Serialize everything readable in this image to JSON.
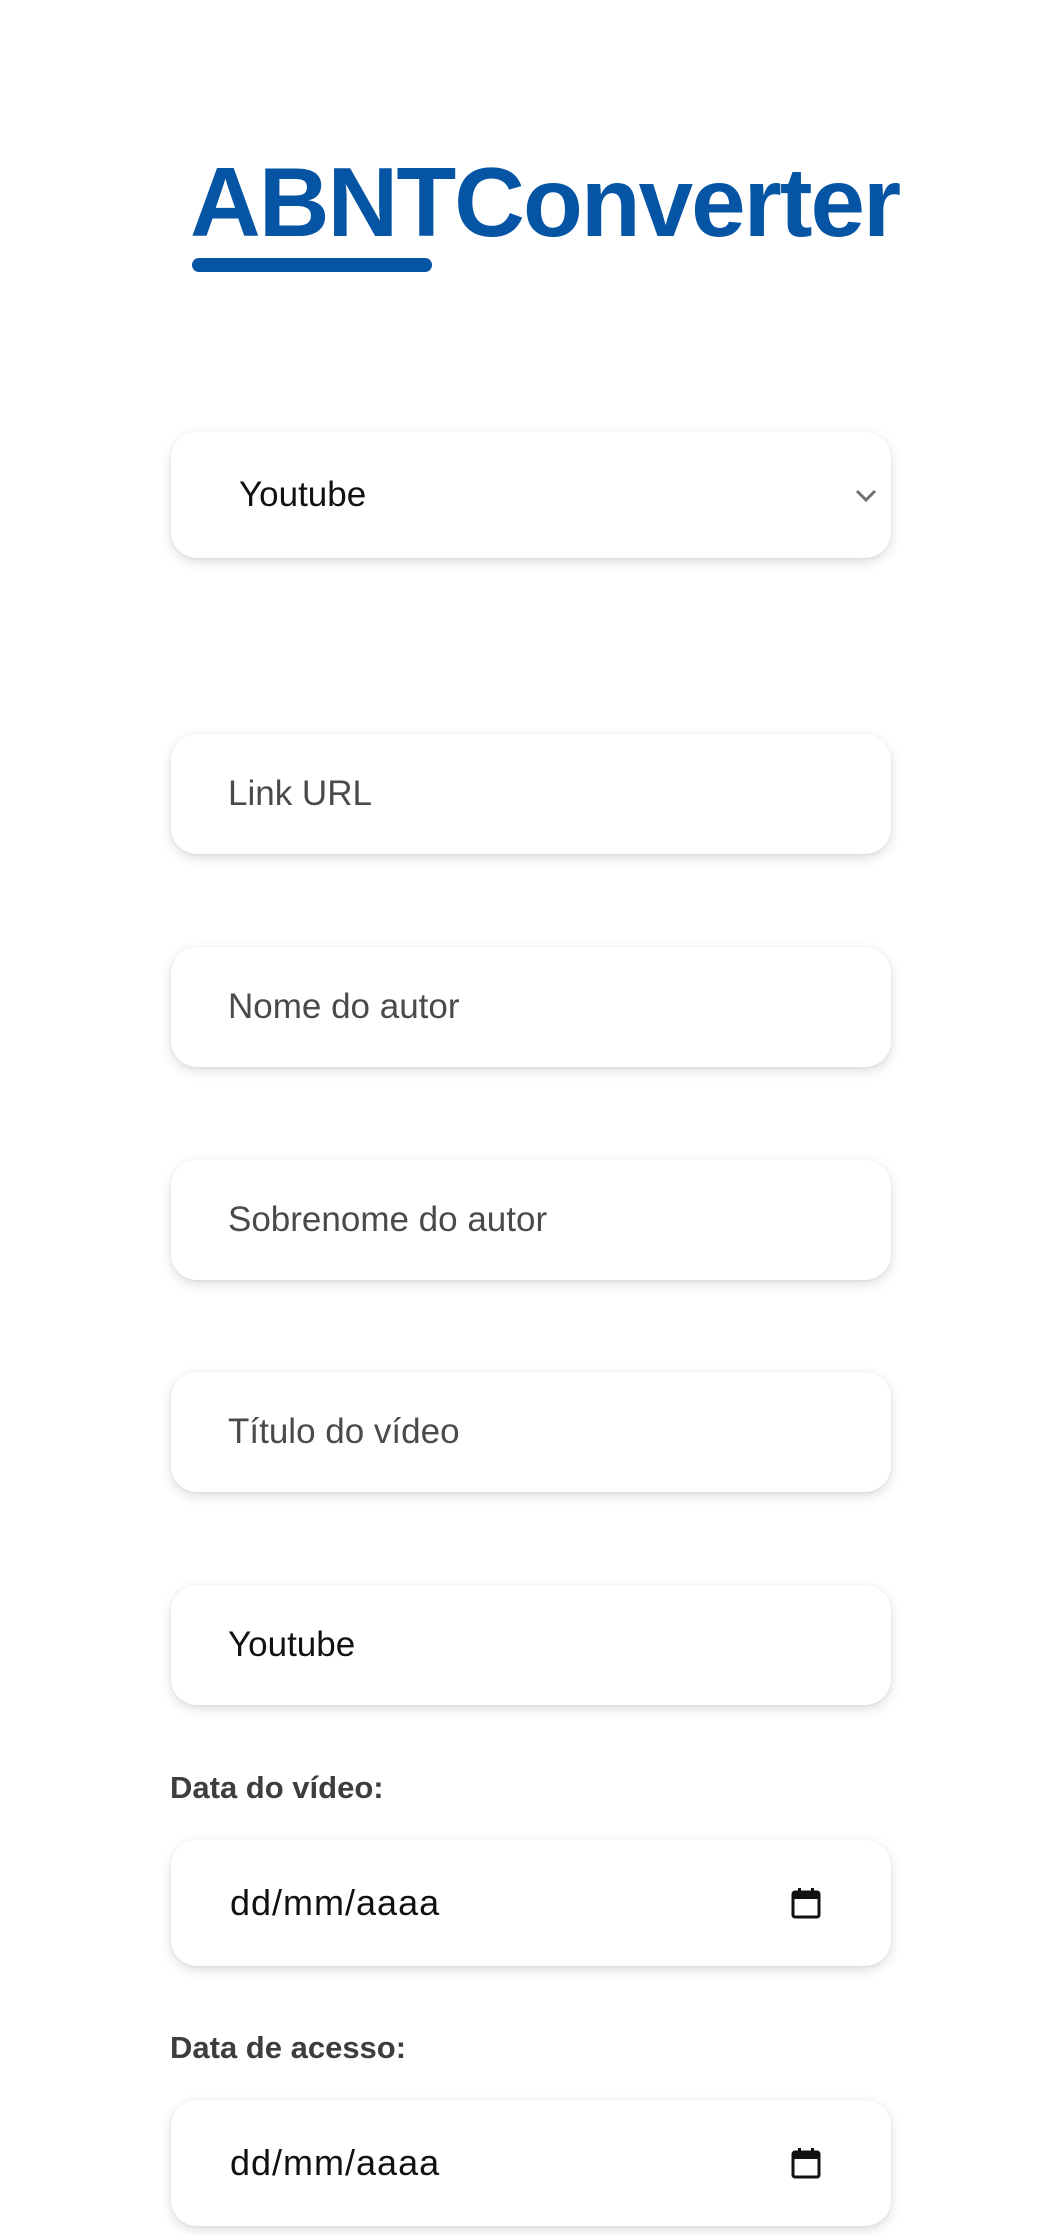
{
  "header": {
    "logo_text": "ABNTConverter"
  },
  "form": {
    "source_select": {
      "selected": "Youtube",
      "icon": "chevron-down-icon"
    },
    "link_url": {
      "placeholder": "Link URL"
    },
    "author_first_name": {
      "placeholder": "Nome do autor"
    },
    "author_last_name": {
      "placeholder": "Sobrenome do autor"
    },
    "video_title": {
      "placeholder": "Título do vídeo"
    },
    "platform": {
      "value": "Youtube"
    },
    "video_date": {
      "label": "Data do vídeo:",
      "placeholder": "dd/mm/aaaa",
      "icon": "calendar-icon"
    },
    "access_date": {
      "label": "Data de acesso:",
      "placeholder": "dd/mm/aaaa",
      "icon": "calendar-icon"
    }
  },
  "colors": {
    "brand": "#0655a5",
    "background": "#ffffff",
    "label": "#3d3d3d",
    "placeholder": "#4a4a4a"
  }
}
